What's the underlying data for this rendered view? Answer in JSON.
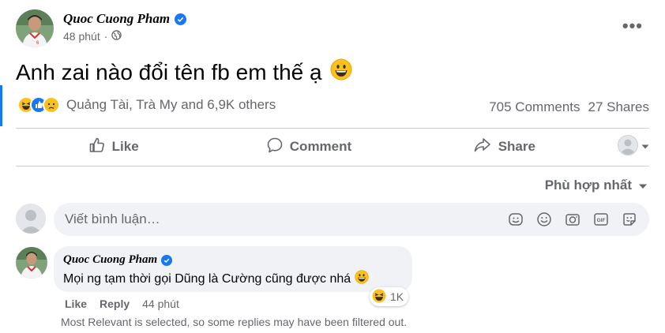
{
  "post": {
    "author": "Quoc Cuong Pham",
    "time": "48 phút",
    "text": "Anh zai nào đổi tên fb em thế ạ",
    "reaction_summary": "Quảng Tài, Trà My and 6,9K others",
    "comments_count": "705 Comments",
    "shares_count": "27 Shares"
  },
  "actions": {
    "like": "Like",
    "comment": "Comment",
    "share": "Share"
  },
  "sort": {
    "label": "Phù hợp nhất"
  },
  "composer": {
    "placeholder": "Viết bình luận…"
  },
  "comment": {
    "author": "Quoc Cuong Pham",
    "text": "Mọi ng tạm thời gọi Dũng là Cường cũng được nhá",
    "reaction_count": "1K",
    "like": "Like",
    "reply": "Reply",
    "time": "44 phút"
  },
  "filter_note": "Most Relevant is selected, so some replies may have been filtered out.",
  "colors": {
    "accent": "#1877f2",
    "muted": "#65676b",
    "bubble": "#f0f2f5",
    "divider": "#ced0d4"
  }
}
